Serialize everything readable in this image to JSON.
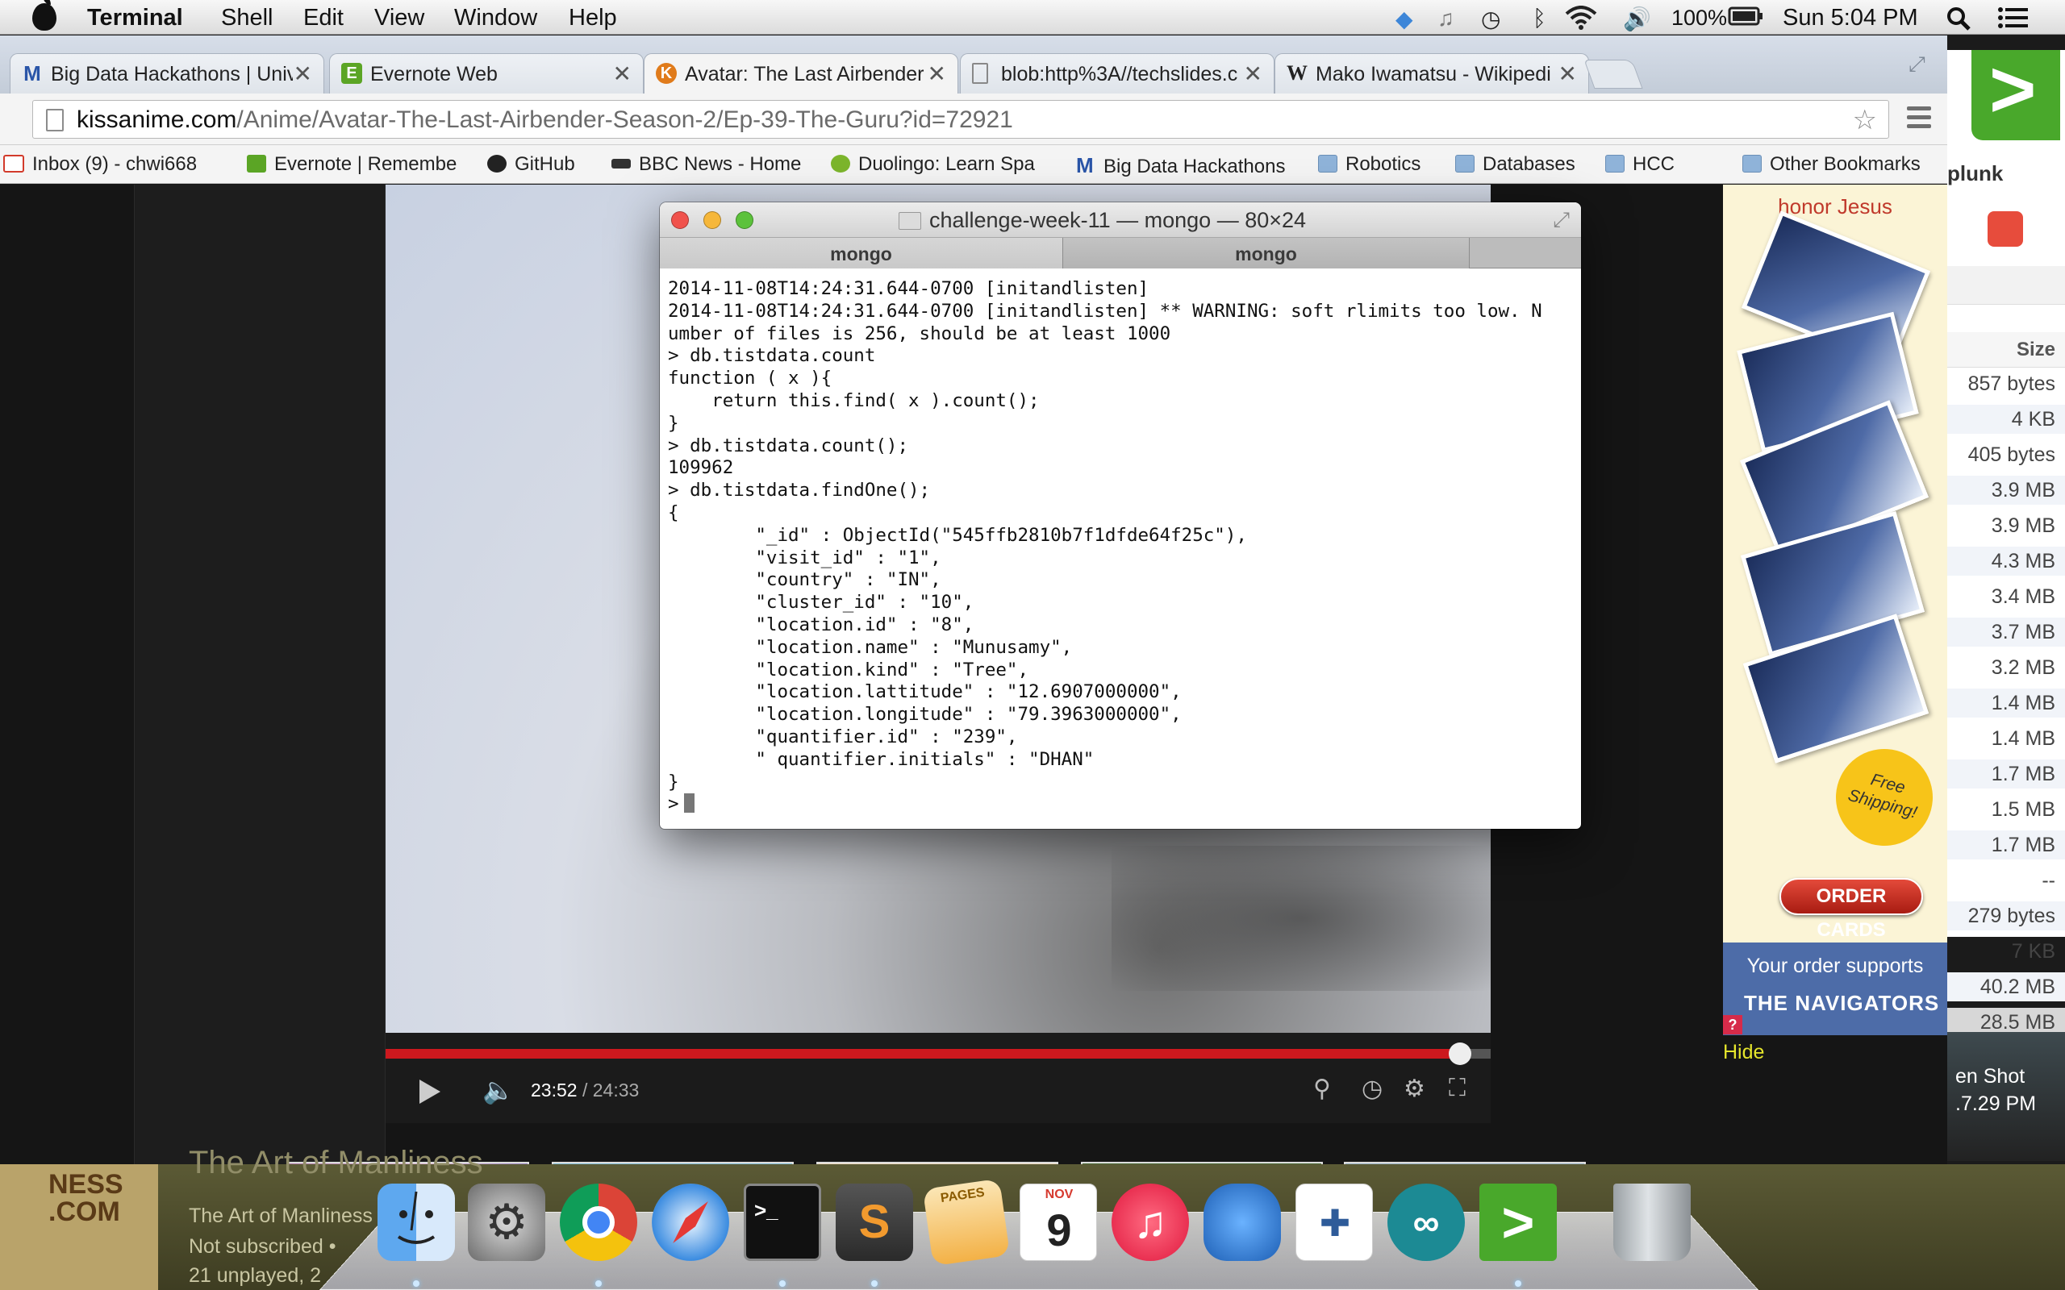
{
  "menubar": {
    "app_name": "Terminal",
    "menus": [
      "Shell",
      "Edit",
      "View",
      "Window",
      "Help"
    ],
    "battery": "100%",
    "clock": "Sun 5:04 PM",
    "status_icons": [
      "dropbox-icon",
      "notification-icon",
      "time-machine-icon",
      "bluetooth-icon",
      "wifi-icon",
      "volume-icon",
      "battery-icon",
      "spotlight-icon",
      "notification-center-icon"
    ]
  },
  "browser": {
    "tabs": [
      {
        "title": "Big Data Hackathons | Univ",
        "favicon": "M"
      },
      {
        "title": "Evernote Web",
        "favicon": "E"
      },
      {
        "title": "Avatar: The Last Airbender",
        "favicon": "K"
      },
      {
        "title": "blob:http%3A//techslides.c",
        "favicon": ""
      },
      {
        "title": "Mako Iwamatsu - Wikipedi",
        "favicon": "W"
      }
    ],
    "url_host": "kissanime.com",
    "url_path": "/Anime/Avatar-The-Last-Airbender-Season-2/Ep-39-The-Guru?id=72921",
    "bookmarks": [
      {
        "label": "Inbox (9) - chwi668",
        "icon": "gmail-icon"
      },
      {
        "label": "Evernote | Remembe",
        "icon": "evernote-icon"
      },
      {
        "label": "GitHub",
        "icon": "github-icon"
      },
      {
        "label": "BBC News - Home",
        "icon": "bbc-icon"
      },
      {
        "label": "Duolingo: Learn Spa",
        "icon": "duolingo-icon"
      },
      {
        "label": "Big Data Hackathons",
        "icon": "m-icon"
      },
      {
        "label": "Robotics",
        "icon": "folder-icon"
      },
      {
        "label": "Databases",
        "icon": "folder-icon"
      },
      {
        "label": "HCC",
        "icon": "folder-icon"
      },
      {
        "label": "Other Bookmarks",
        "icon": "folder-icon"
      }
    ]
  },
  "video": {
    "current_time": "23:52",
    "duration": "/ 24:33",
    "progress_fraction": 0.9722
  },
  "ad": {
    "headline": "honor Jesus",
    "shipping": "Free Shipping!",
    "order_button": "ORDER CARDS",
    "supports": "Your order supports",
    "brand": "THE NAVIGATORS",
    "help": "?",
    "hide": "Hide"
  },
  "finder": {
    "app_label": "plunk",
    "size_header": "Size",
    "sizes": [
      "857 bytes",
      "4 KB",
      "405 bytes",
      "3.9 MB",
      "3.9 MB",
      "4.3 MB",
      "3.4 MB",
      "3.7 MB",
      "3.2 MB",
      "1.4 MB",
      "1.4 MB",
      "1.7 MB",
      "1.5 MB",
      "1.7 MB",
      "--",
      "279 bytes",
      "7 KB",
      "40.2 MB",
      "28.5 MB"
    ],
    "desktop_label_1": "en Shot",
    "desktop_label_2": ".7.29 PM"
  },
  "terminal": {
    "window_title": "challenge-week-11 — mongo — 80×24",
    "tabs": [
      "mongo",
      "mongo"
    ],
    "lines": [
      "2014-11-08T14:24:31.644-0700 [initandlisten]",
      "2014-11-08T14:24:31.644-0700 [initandlisten] ** WARNING: soft rlimits too low. N",
      "umber of files is 256, should be at least 1000",
      "> db.tistdata.count",
      "function ( x ){",
      "    return this.find( x ).count();",
      "}",
      "> db.tistdata.count();",
      "109962",
      "> db.tistdata.findOne();",
      "{",
      "        \"_id\" : ObjectId(\"545ffb2810b7f1dfde64f25c\"),",
      "        \"visit_id\" : \"1\",",
      "        \"country\" : \"IN\",",
      "        \"cluster_id\" : \"10\",",
      "        \"location.id\" : \"8\",",
      "        \"location.name\" : \"Munusamy\",",
      "        \"location.kind\" : \"Tree\",",
      "        \"location.lattitude\" : \"12.6907000000\",",
      "        \"location.longitude\" : \"79.3963000000\",",
      "        \"quantifier.id\" : \"239\",",
      "        \" quantifier.initials\" : \"DHAN\"",
      "}",
      ">"
    ]
  },
  "dock": {
    "left_logo_1": "NESS",
    "left_logo_2": ".COM",
    "background_title": "The Art of Manliness",
    "channel_name": "The Art of Manliness",
    "subscription": "Not subscribed •",
    "unplayed": "21 unplayed, 2",
    "calendar_month": "NOV",
    "calendar_day": "9",
    "pages_label": "PAGES",
    "apps": [
      "finder-icon",
      "system-preferences-icon",
      "chrome-icon",
      "safari-icon",
      "terminal-icon",
      "sublime-text-icon",
      "pages-icon",
      "calendar-icon",
      "itunes-icon",
      "sequel-pro-icon",
      "tableau-icon",
      "arduino-icon",
      "splunk-icon",
      "trash-icon"
    ]
  },
  "colors": {
    "progress_red": "#cc181e",
    "ad_button_red": "#c0281a",
    "ad_footer_blue": "#4d6ca8"
  }
}
